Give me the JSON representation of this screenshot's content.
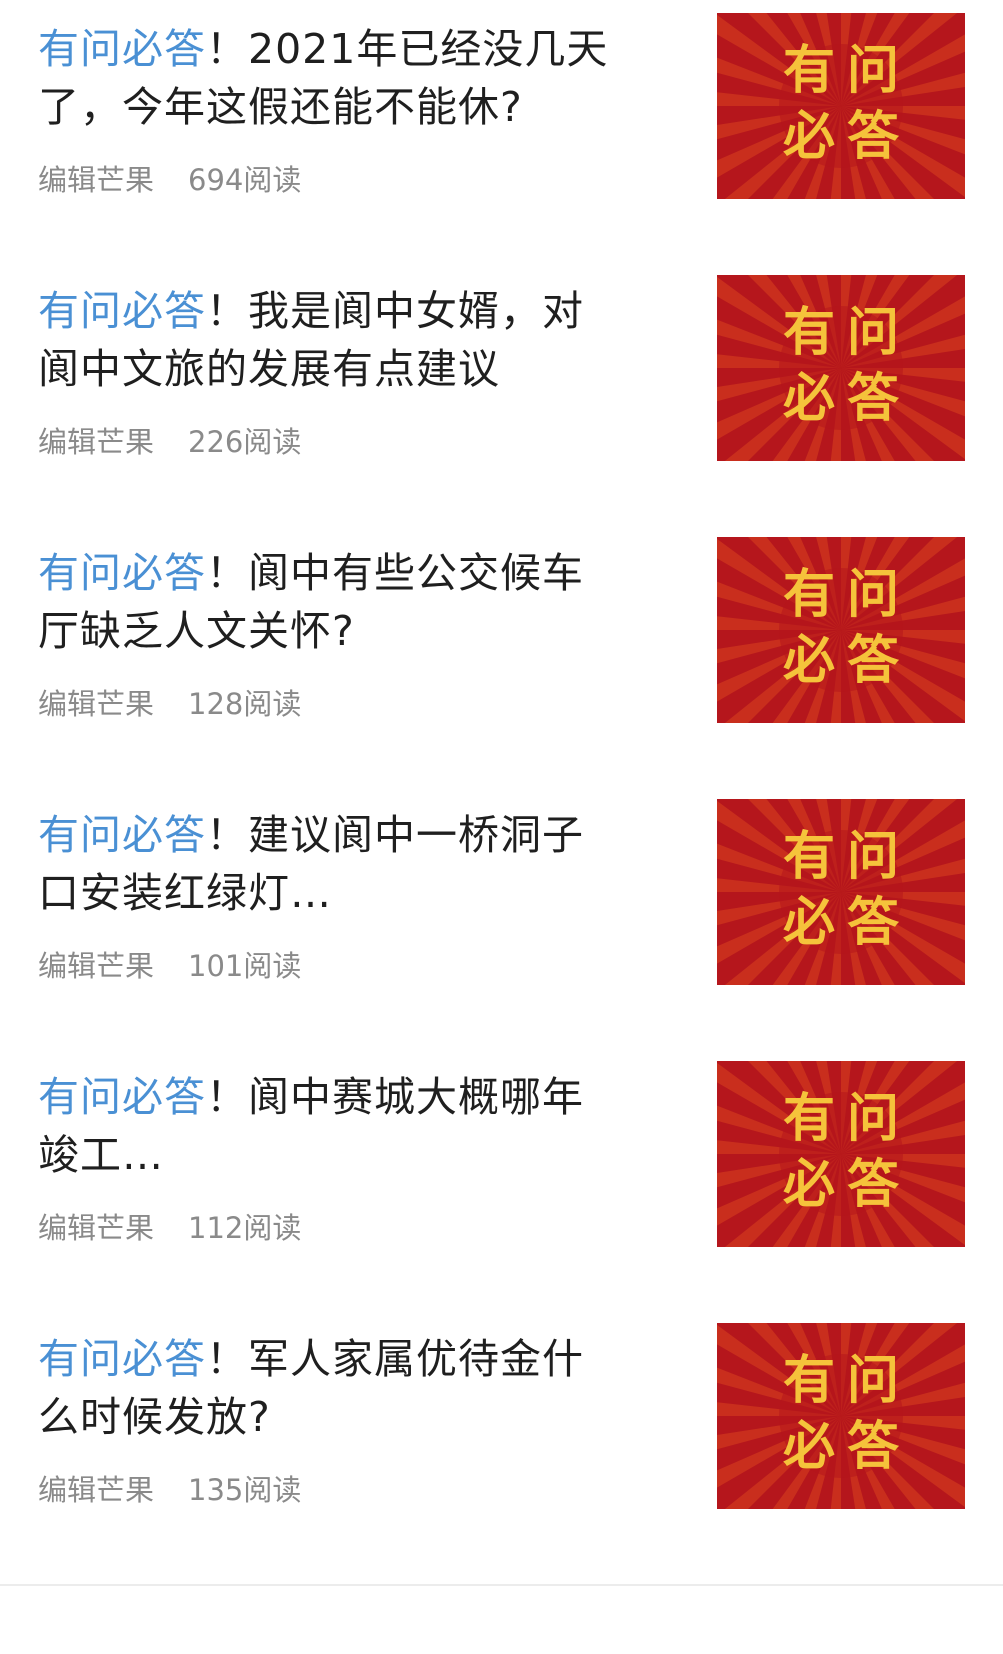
{
  "colors": {
    "tag": "#4a90d4",
    "title": "#1f1f1f",
    "meta": "#8a8a8a",
    "thumb_bg": "#b5161c",
    "thumb_ray": "#d9431f",
    "thumb_text": "#f5c33b",
    "divider": "#ececec"
  },
  "articles": [
    {
      "tag": "有问必答",
      "punct": "！",
      "title": "2021年已经没几天了，今年这假还能不能休?",
      "author": "编辑芒果",
      "reads": "694阅读",
      "thumb_text": [
        "有",
        "问",
        "必",
        "答"
      ]
    },
    {
      "tag": "有问必答",
      "punct": "！",
      "title": "我是阆中女婿，对阆中文旅的发展有点建议",
      "author": "编辑芒果",
      "reads": "226阅读",
      "thumb_text": [
        "有",
        "问",
        "必",
        "答"
      ]
    },
    {
      "tag": "有问必答",
      "punct": "！",
      "title": "阆中有些公交候车厅缺乏人文关怀?",
      "author": "编辑芒果",
      "reads": "128阅读",
      "thumb_text": [
        "有",
        "问",
        "必",
        "答"
      ]
    },
    {
      "tag": "有问必答",
      "punct": "！",
      "title": "建议阆中一桥洞子口安装红绿灯…",
      "author": "编辑芒果",
      "reads": "101阅读",
      "thumb_text": [
        "有",
        "问",
        "必",
        "答"
      ]
    },
    {
      "tag": "有问必答",
      "punct": "！",
      "title": "阆中赛城大概哪年竣工…",
      "author": "编辑芒果",
      "reads": "112阅读",
      "thumb_text": [
        "有",
        "问",
        "必",
        "答"
      ]
    },
    {
      "tag": "有问必答",
      "punct": "！",
      "title": "军人家属优待金什么时候发放?",
      "author": "编辑芒果",
      "reads": "135阅读",
      "thumb_text": [
        "有",
        "问",
        "必",
        "答"
      ]
    }
  ]
}
